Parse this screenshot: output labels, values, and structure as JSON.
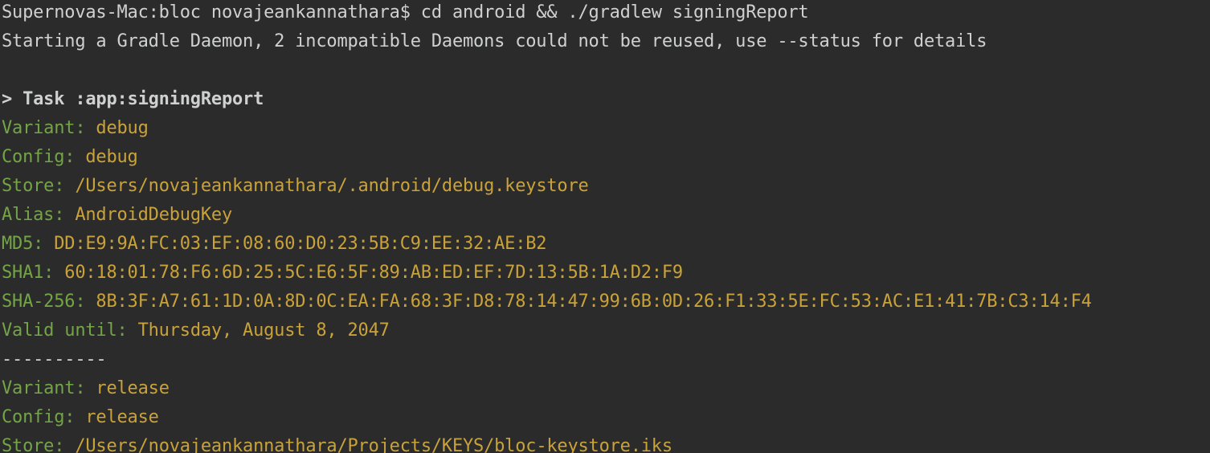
{
  "terminal": {
    "prompt_line": "Supernovas-Mac:bloc novajeankannathara$ cd android && ./gradlew signingReport",
    "daemon_line": "Starting a Gradle Daemon, 2 incompatible Daemons could not be reused, use --status for details",
    "task_line": "> Task :app:signingReport",
    "separator": "----------",
    "colors": {
      "background": "#2b2b2b",
      "plain_text": "#cfd0d0",
      "key_text": "#73a546",
      "value_text": "#c9a23a"
    },
    "debug": {
      "variant_key": "Variant:",
      "variant_val": "debug",
      "config_key": "Config:",
      "config_val": "debug",
      "store_key": "Store:",
      "store_val": "/Users/novajeankannathara/.android/debug.keystore",
      "alias_key": "Alias:",
      "alias_val": "AndroidDebugKey",
      "md5_key": "MD5:",
      "md5_val": "DD:E9:9A:FC:03:EF:08:60:D0:23:5B:C9:EE:32:AE:B2",
      "sha1_key": "SHA1:",
      "sha1_val": "60:18:01:78:F6:6D:25:5C:E6:5F:89:AB:ED:EF:7D:13:5B:1A:D2:F9",
      "sha256_key": "SHA-256:",
      "sha256_val": "8B:3F:A7:61:1D:0A:8D:0C:EA:FA:68:3F:D8:78:14:47:99:6B:0D:26:F1:33:5E:FC:53:AC:E1:41:7B:C3:14:F4",
      "valid_key": "Valid until:",
      "valid_val": "Thursday, August 8, 2047"
    },
    "release": {
      "variant_key": "Variant:",
      "variant_val": "release",
      "config_key": "Config:",
      "config_val": "release",
      "store_key": "Store:",
      "store_val": "/Users/novajeankannathara/Projects/KEYS/bloc-keystore.iks"
    }
  }
}
